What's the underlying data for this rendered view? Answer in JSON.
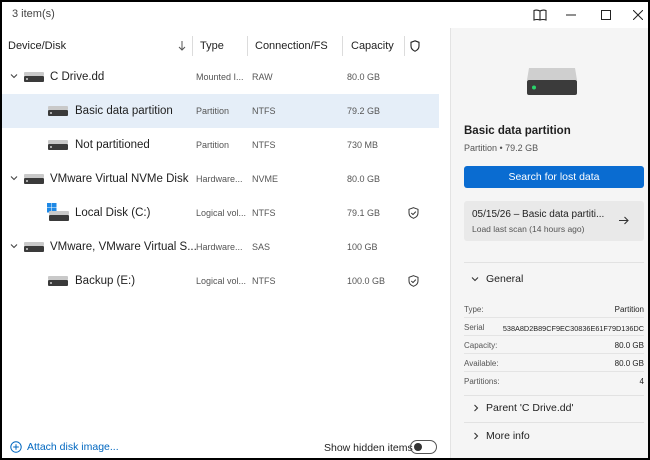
{
  "titlebar": {
    "count": "3 item(s)"
  },
  "columns": {
    "device": "Device/Disk",
    "type": "Type",
    "connection": "Connection/FS",
    "capacity": "Capacity"
  },
  "rows": [
    {
      "name": "C Drive.dd",
      "type": "Mounted I...",
      "fs": "RAW",
      "capacity": "80.0 GB"
    },
    {
      "name": "Basic data partition",
      "type": "Partition",
      "fs": "NTFS",
      "capacity": "79.2 GB"
    },
    {
      "name": "Not partitioned",
      "type": "Partition",
      "fs": "NTFS",
      "capacity": "730 MB"
    },
    {
      "name": "VMware Virtual NVMe Disk",
      "type": "Hardware...",
      "fs": "NVME",
      "capacity": "80.0 GB"
    },
    {
      "name": "Local Disk (C:)",
      "type": "Logical vol...",
      "fs": "NTFS",
      "capacity": "79.1 GB"
    },
    {
      "name": "VMware, VMware Virtual S...",
      "type": "Hardware...",
      "fs": "SAS",
      "capacity": "100 GB"
    },
    {
      "name": "Backup (E:)",
      "type": "Logical vol...",
      "fs": "NTFS",
      "capacity": "100.0 GB"
    }
  ],
  "footer": {
    "attach": "Attach disk image...",
    "show_hidden": "Show hidden items"
  },
  "details": {
    "title": "Basic data partition",
    "subtitle": "Partition • 79.2 GB",
    "search_button": "Search for lost data",
    "scan_title": "05/15/26 – Basic data partiti...",
    "scan_subtitle": "Load last scan (14 hours ago)",
    "general": "General",
    "props": [
      {
        "key": "Type:",
        "value": "Partition"
      },
      {
        "key": "Serial",
        "value": "538A8D2B89CF9EC30836E61F79D136DC"
      },
      {
        "key": "Capacity:",
        "value": "80.0 GB"
      },
      {
        "key": "Available:",
        "value": "80.0 GB"
      },
      {
        "key": "Partitions:",
        "value": "4"
      }
    ],
    "parent": "Parent 'C Drive.dd'",
    "more": "More info"
  },
  "colors": {
    "accent": "#0a6cd1",
    "selected_row": "#e5eef8",
    "link": "#0067c0"
  }
}
